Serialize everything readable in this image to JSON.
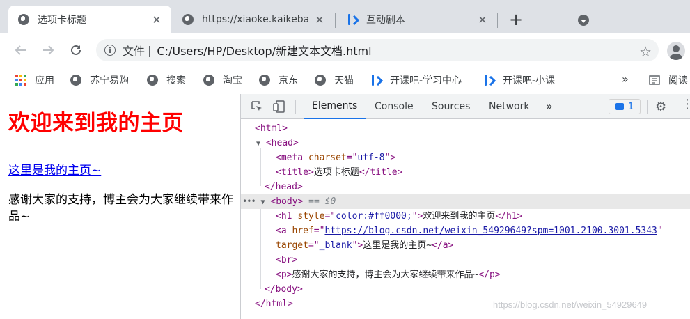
{
  "browser": {
    "tabs": [
      {
        "title": "选项卡标题",
        "active": true
      },
      {
        "title": "https://xiaoke.kaikeba",
        "active": false
      },
      {
        "title": "互动剧本",
        "active": false
      }
    ],
    "new_tab": "+",
    "address": {
      "scheme": "文件",
      "url": "C:/Users/HP/Desktop/新建文本文档.html"
    },
    "bookmarks": [
      "应用",
      "苏宁易购",
      "搜索",
      "淘宝",
      "京东",
      "天猫",
      "开课吧-学习中心",
      "开课吧-小课"
    ],
    "bookmarks_more": "»",
    "reading_list": "阅读"
  },
  "page": {
    "heading": "欢迎来到我的主页",
    "link_text": "这里是我的主页~",
    "paragraph": "感谢大家的支持，博主会为大家继续带来作品~",
    "heading_color": "#ff0000"
  },
  "devtools": {
    "tabs": [
      "Elements",
      "Console",
      "Sources",
      "Network"
    ],
    "more_tabs": "»",
    "messages_count": "1",
    "dom": {
      "html_open": "<html>",
      "head_open": "<head>",
      "meta": {
        "tag_open": "<meta ",
        "attr": "charset",
        "eq": "=\"",
        "val": "utf-8",
        "end": "\">"
      },
      "title": {
        "open": "<title>",
        "text": "选项卡标题",
        "close": "</title>"
      },
      "head_close": "</head>",
      "body_open": "<body>",
      "body_marker": "== $0",
      "h1": {
        "open": "<h1 ",
        "attr": "style",
        "eq": "=\"",
        "val": "color:#ff0000;",
        "end": "\">",
        "text": "欢迎来到我的主页",
        "close": "</h1>"
      },
      "a": {
        "open": "<a ",
        "attr": "href",
        "eq": "=\"",
        "href": "https://blog.csdn.net/weixin_54929649?spm=1001.2100.3001.5343",
        "quote": "\"",
        "target_attr": "target",
        "target_val": "_blank",
        "end": "\">",
        "text": "这里是我的主页~",
        "close": "</a>"
      },
      "br": "<br>",
      "p": {
        "open": "<p>",
        "text": "感谢大家的支持，博主会为大家继续带来作品~",
        "close": "</p>"
      },
      "body_close": "</body>",
      "html_close": "</html>"
    }
  },
  "watermark": "https://blog.csdn.net/weixin_54929649"
}
